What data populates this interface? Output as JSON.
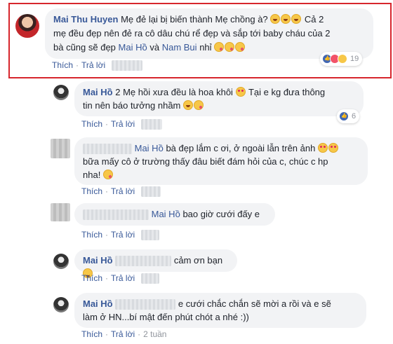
{
  "comments": [
    {
      "author": "Mai Thu Huyen",
      "text_line1": "Mẹ đẻ lại bị biến thành Mẹ chồng à?",
      "text_line1b": "Cả 2",
      "text_line2": "mẹ đều đẹp nên đẻ ra cô dâu chú rể đẹp và sắp tới baby cháu của 2",
      "text_line3a": "bà cũng sẽ đẹp",
      "mention1": "Mai Hồ",
      "text_and": "và",
      "mention2": "Nam Bui",
      "text_line3b": "nhỉ",
      "reaction_count": "19",
      "like": "Thích",
      "reply": "Trả lời"
    },
    {
      "author": "Mai Hồ",
      "text_line1": "2 Mẹ hồi xưa đều là hoa khôi",
      "text_line1b": "Tại e kg đưa thông",
      "text_line2": "tin nên báo tưởng nhầm",
      "reaction_count": "6",
      "like": "Thích",
      "reply": "Trả lời"
    },
    {
      "mention": "Mai Hồ",
      "text_line1": "bà đẹp lắm c ơi, ở ngoài lẫn trên ảnh",
      "text_line2": "bữa mấy cô ở trường thấy đâu biết đám hỏi của c, chúc c hp",
      "text_line3": "nha!",
      "like": "Thích",
      "reply": "Trả lời"
    },
    {
      "mention": "Mai Hồ",
      "text": "bao giờ cưới đấy e",
      "like": "Thích",
      "reply": "Trả lời"
    },
    {
      "author": "Mai Hồ",
      "text": "cảm ơn bạn",
      "like": "Thích",
      "reply": "Trả lời"
    },
    {
      "author": "Mai Hồ",
      "text_line1": "e cưới chắc chắn sẽ mời a rồi và e sẽ",
      "text_line2": "làm ở HN...bí mật đến phút chót a nhé :))",
      "like": "Thích",
      "reply": "Trả lời",
      "time": "2 tuần"
    }
  ],
  "colors": {
    "link": "#385898",
    "bubble": "#f2f3f5",
    "highlight": "#d7262d"
  },
  "icons": [
    "laugh-emoji-icon",
    "kiss-emoji-icon",
    "heart-eyes-emoji-icon",
    "smile-emoji-icon",
    "like-reaction-icon",
    "love-reaction-icon",
    "haha-reaction-icon"
  ]
}
